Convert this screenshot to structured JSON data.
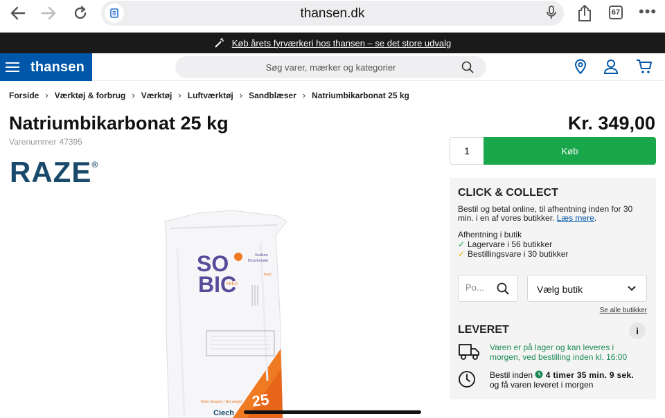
{
  "browser": {
    "domain": "thansen.dk",
    "tab_count": "67",
    "back_icon": "arrow-left-icon",
    "forward_icon": "arrow-right-icon",
    "reload_icon": "reload-icon"
  },
  "promo": {
    "text": "Køb årets fyrværkeri hos thansen – se det store udvalg"
  },
  "header": {
    "logo": "thansen",
    "search_placeholder": "Søg varer, mærker og kategorier",
    "brand_color": "#0056a8"
  },
  "breadcrumb": [
    "Forside",
    "Værktøj & forbrug",
    "Værktøj",
    "Luftværktøj",
    "Sandblæser",
    "Natriumbikarbonat 25 kg"
  ],
  "product": {
    "title": "Natriumbikarbonat 25 kg",
    "sku_label": "Varenummer",
    "sku": "47395",
    "brand": "RAZE",
    "brand_mark": "®",
    "price": "Kr. 349,00",
    "quantity": "1",
    "buy_label": "Køb",
    "buy_color": "#1aa64b",
    "bag": {
      "logo_line1": "SO",
      "logo_line2": "BIC",
      "feed": "FEED",
      "sodium": "Sodium",
      "bicarbonate": "Bicarbonate",
      "feed_small": "feed",
      "weight": "25",
      "netto": "Netto Gewicht / Net weight",
      "maker": "Ciech"
    }
  },
  "click_collect": {
    "heading": "CLICK & COLLECT",
    "desc": "Bestil og betal online, til afhentning inden for 30 min. i en af vores butikker.",
    "read_more": "Læs mere",
    "pickup_label": "Afhentning i butik",
    "stock_line": "Lagervare i 56 butikker",
    "order_line": "Bestillingsvare i 30 butikker",
    "postal_placeholder": "Po...",
    "store_select": "Vælg butik",
    "all_stores": "Se alle butikker"
  },
  "delivery": {
    "heading": "LEVERET",
    "info": "i",
    "stock_msg": "Varen er på lager og kan leveres i morgen, ved bestilling inden kl. 16:00",
    "order_before": "Bestil inden",
    "countdown": "4 timer 35 min. 9 sek.",
    "delivered": "og få varen leveret i morgen"
  }
}
